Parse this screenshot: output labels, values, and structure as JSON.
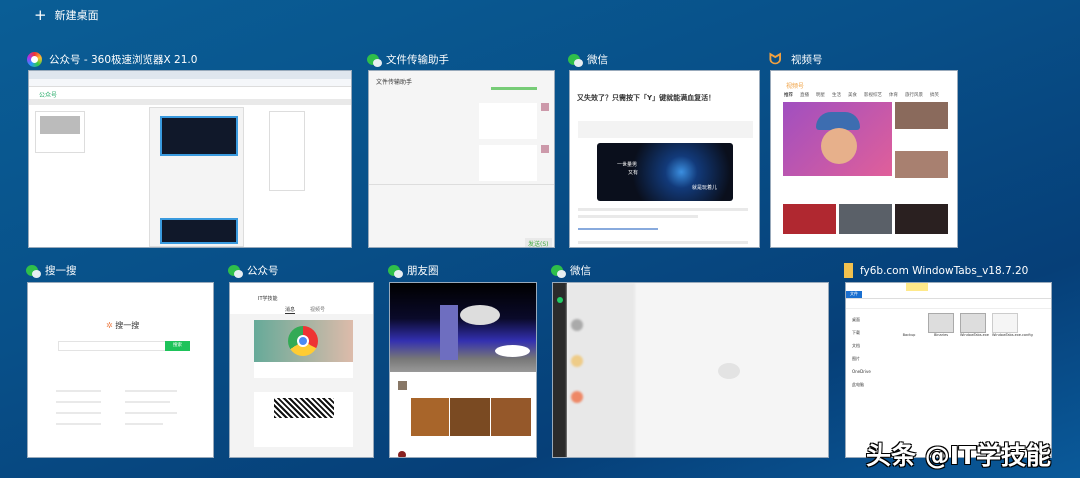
{
  "new_desktop": {
    "icon": "plus-icon",
    "label": "新建桌面"
  },
  "windows": [
    {
      "title": "公众号 - 360极速浏览器X 21.0",
      "icon": "360-browser-icon",
      "content": {
        "page_title": "公众号"
      }
    },
    {
      "title": "文件传输助手",
      "icon": "wechat-icon",
      "content": {
        "header": "文件传输助手",
        "send_label": "发送(S)"
      }
    },
    {
      "title": "微信",
      "icon": "wechat-icon",
      "content": {
        "headline": "又失效了？只需按下「Y」键就能满血复活！",
        "image_text_1": "一世量男",
        "image_text_2": "又有",
        "image_tag": "就是玩着儿"
      }
    },
    {
      "title": "视频号",
      "icon": "channels-icon",
      "content": {
        "brand": "视频号",
        "tabs": [
          "推荐",
          "直播",
          "明星",
          "生活",
          "美食",
          "影视综艺",
          "体育",
          "旅行风景",
          "搞笑"
        ]
      }
    },
    {
      "title": "搜一搜",
      "icon": "wechat-icon",
      "content": {
        "brand": "搜一搜",
        "search_button": "搜索"
      }
    },
    {
      "title": "公众号",
      "icon": "wechat-icon",
      "content": {
        "account": "IT学技能",
        "tabs": [
          "消息",
          "视频号"
        ]
      }
    },
    {
      "title": "朋友圈",
      "icon": "wechat-icon",
      "content": {}
    },
    {
      "title": "微信",
      "icon": "wechat-icon",
      "content": {}
    },
    {
      "title": "fy6b.com WindowTabs_v18.7.20",
      "icon": "folder-icon",
      "content": {
        "ribbon_tab": "文件",
        "sidebar": [
          "桌面",
          "下载",
          "文档",
          "图片",
          "OneDrive",
          "此电脑"
        ],
        "files": [
          "Backup",
          "Binaries",
          "WindowTabs.exe",
          "WindowTabs.exe.config"
        ]
      }
    }
  ],
  "watermark": "头条 @IT学技能"
}
